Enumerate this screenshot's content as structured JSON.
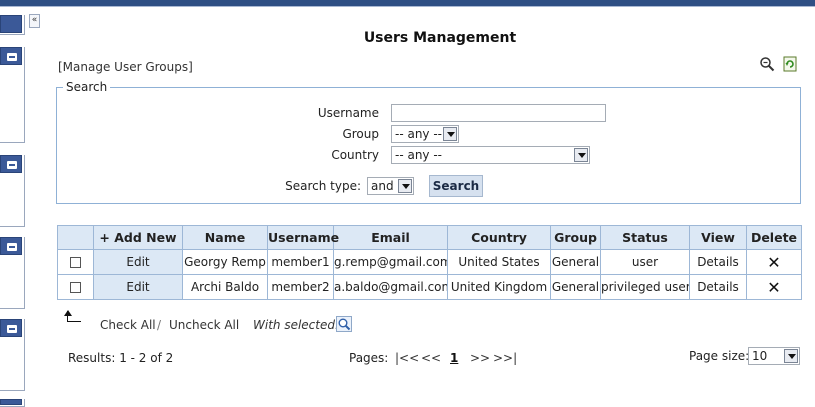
{
  "header": {
    "title": "Users Management",
    "collapse_label": "«",
    "manage_groups_label": "[Manage User Groups]",
    "icons": [
      "zoom-icon",
      "refresh-icon"
    ]
  },
  "search": {
    "legend": "Search",
    "username_label": "Username",
    "username_value": "",
    "group_label": "Group",
    "group_value": "-- any --",
    "country_label": "Country",
    "country_value": "-- any --",
    "search_type_label": "Search type:",
    "search_type_value": "and",
    "search_button": "Search"
  },
  "table": {
    "columns": [
      "+ Add New",
      "Name",
      "Username",
      "Email",
      "Country",
      "Group",
      "Status",
      "View",
      "Delete"
    ],
    "rows": [
      {
        "edit": "Edit",
        "name": "Georgy Remp",
        "username": "member1",
        "email": "g.remp@gmail.com",
        "country": "United States",
        "group": "General",
        "status": "user",
        "view": "Details"
      },
      {
        "edit": "Edit",
        "name": "Archi Baldo",
        "username": "member2",
        "email": "a.baldo@gmail.com",
        "country": "United Kingdom",
        "group": "General",
        "status": "privileged user",
        "view": "Details"
      }
    ]
  },
  "bulk": {
    "check_all": "Check All",
    "separator": "/",
    "uncheck_all": "Uncheck All",
    "with_selected": "With selected:"
  },
  "footer": {
    "results": "Results: 1 - 2 of 2",
    "pages_label": "Pages:",
    "first": "|<<",
    "prev": "<<",
    "current_page": "1",
    "next": ">>",
    "last": ">>|",
    "page_size_label": "Page size:",
    "page_size_value": "10"
  },
  "colors": {
    "accent": "#3b5998",
    "header_cell": "#dce8f5",
    "border": "#9db7d6"
  }
}
